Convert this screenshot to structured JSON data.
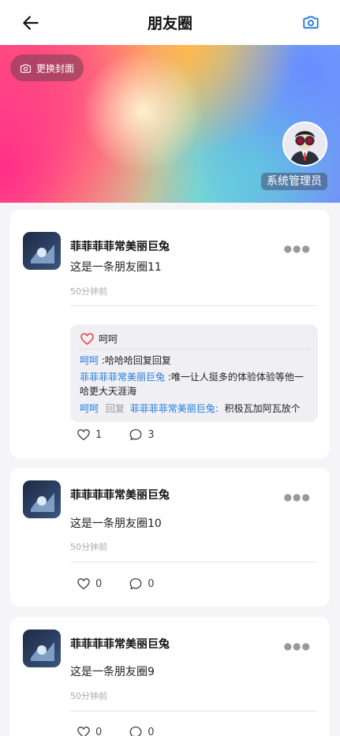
{
  "header": {
    "title": "朋友圈"
  },
  "cover": {
    "change_label": "更换封面",
    "admin_name": "系统管理员"
  },
  "colors": {
    "accent": "#1f7ae0",
    "like_red": "#e64340"
  },
  "posts": [
    {
      "author": "菲菲菲菲常美丽巨兔",
      "text": "这是一条朋友圈11",
      "time": "50分钟前",
      "likes_count": "1",
      "comments_count": "3",
      "liked_by": "呵呵",
      "comments": [
        {
          "user": "呵呵",
          "text": ":哈哈哈回复回复"
        },
        {
          "user": "菲菲菲菲常美丽巨兔",
          "text": ":唯一让人挺多的体验体验等他一哈更大天涯海"
        },
        {
          "user": "呵呵",
          "reply_word": "回复",
          "reply_to": "菲菲菲菲常美丽巨兔:",
          "text": "积极瓦加阿瓦放个"
        }
      ]
    },
    {
      "author": "菲菲菲菲常美丽巨兔",
      "text": "这是一条朋友圈10",
      "time": "50分钟前",
      "likes_count": "0",
      "comments_count": "0"
    },
    {
      "author": "菲菲菲菲常美丽巨兔",
      "text": "这是一条朋友圈9",
      "time": "50分钟前",
      "likes_count": "0",
      "comments_count": "0"
    }
  ],
  "icons": [
    "back-arrow-icon",
    "camera-icon",
    "more-icon",
    "heart-icon",
    "comment-icon"
  ]
}
